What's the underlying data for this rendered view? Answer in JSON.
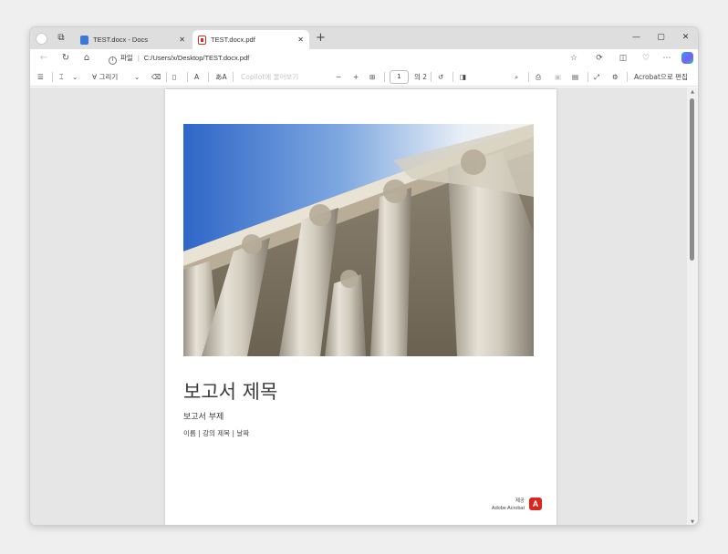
{
  "tabs": [
    {
      "label": "TEST.docx - Docs",
      "close": "✕"
    },
    {
      "label": "TEST.docx.pdf",
      "close": "✕"
    }
  ],
  "new_tab": "+",
  "window_controls": {
    "minimize": "—",
    "maximize": "▢",
    "close": "✕"
  },
  "address": {
    "scheme_label": "파일",
    "url": "C:/Users/x/Desktop/TEST.docx.pdf"
  },
  "toolbar": {
    "contents_icon": "☰",
    "highlight_chevron": "⌄",
    "draw_label": "그리기",
    "draw_chevron": "⌄",
    "read_aloud_label": "A",
    "translate_label": "あA",
    "copilot_prompt": "Copilot에 물어보기",
    "zoom_out": "−",
    "zoom_in": "+",
    "page_current": "1",
    "page_total": "의 2",
    "acrobat_edit_label": "Acrobat으로 편집"
  },
  "document": {
    "title": "보고서 제목",
    "subtitle": "보고서 부제",
    "meta": "이름 | 강의 제목 | 날짜"
  },
  "adobe_badge": {
    "line1": "제공",
    "line2": "Adobe Acrobat",
    "logo_letter": "A"
  },
  "colors": {
    "accent": "#d7261e",
    "tab_active": "#ffffff",
    "tabbar": "#dedede",
    "viewer_bg": "#e6e6e6"
  }
}
